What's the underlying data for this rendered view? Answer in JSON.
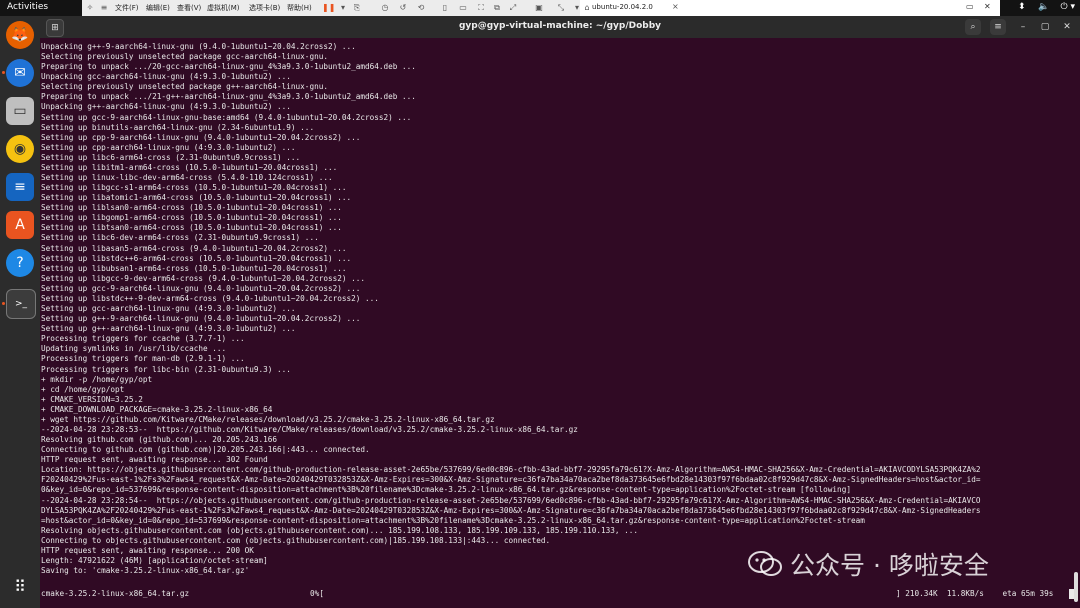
{
  "topbar": {
    "activities": "Activities",
    "menu": [
      "文件(F)",
      "编辑(E)",
      "查看(V)",
      "虚拟机(M)",
      "选项卡(B)",
      "帮助(H)"
    ],
    "vm_tab": "ubuntu-20.04.2.0",
    "tab_close": "×"
  },
  "dock": {
    "items": [
      {
        "name": "firefox-icon",
        "bg": "#e66000"
      },
      {
        "name": "thunderbird-icon",
        "bg": "#1f72d6"
      },
      {
        "name": "files-icon",
        "bg": "#bfbfbf"
      },
      {
        "name": "rhythmbox-icon",
        "bg": "#f5c211"
      },
      {
        "name": "libreoffice-writer-icon",
        "bg": "#1565c0"
      },
      {
        "name": "ubuntu-software-icon",
        "bg": "#e95420"
      },
      {
        "name": "help-icon",
        "bg": "#1e88e5"
      },
      {
        "name": "terminal-icon",
        "bg": "#3c3c3c"
      }
    ]
  },
  "terminal": {
    "title": "gyp@gyp-virtual-machine: ~/gyp/Dobby",
    "lines": [
      "Unpacking g++-9-aarch64-linux-gnu (9.4.0-1ubuntu1~20.04.2cross2) ...",
      "Selecting previously unselected package gcc-aarch64-linux-gnu.",
      "Preparing to unpack .../20-gcc-aarch64-linux-gnu_4%3a9.3.0-1ubuntu2_amd64.deb ...",
      "Unpacking gcc-aarch64-linux-gnu (4:9.3.0-1ubuntu2) ...",
      "Selecting previously unselected package g++-aarch64-linux-gnu.",
      "Preparing to unpack .../21-g++-aarch64-linux-gnu_4%3a9.3.0-1ubuntu2_amd64.deb ...",
      "Unpacking g++-aarch64-linux-gnu (4:9.3.0-1ubuntu2) ...",
      "Setting up gcc-9-aarch64-linux-gnu-base:amd64 (9.4.0-1ubuntu1~20.04.2cross2) ...",
      "Setting up binutils-aarch64-linux-gnu (2.34-6ubuntu1.9) ...",
      "Setting up cpp-9-aarch64-linux-gnu (9.4.0-1ubuntu1~20.04.2cross2) ...",
      "Setting up cpp-aarch64-linux-gnu (4:9.3.0-1ubuntu2) ...",
      "Setting up libc6-arm64-cross (2.31-0ubuntu9.9cross1) ...",
      "Setting up libitm1-arm64-cross (10.5.0-1ubuntu1~20.04cross1) ...",
      "Setting up linux-libc-dev-arm64-cross (5.4.0-110.124cross1) ...",
      "Setting up libgcc-s1-arm64-cross (10.5.0-1ubuntu1~20.04cross1) ...",
      "Setting up libatomic1-arm64-cross (10.5.0-1ubuntu1~20.04cross1) ...",
      "Setting up liblsan0-arm64-cross (10.5.0-1ubuntu1~20.04cross1) ...",
      "Setting up libgomp1-arm64-cross (10.5.0-1ubuntu1~20.04cross1) ...",
      "Setting up libtsan0-arm64-cross (10.5.0-1ubuntu1~20.04cross1) ...",
      "Setting up libc6-dev-arm64-cross (2.31-0ubuntu9.9cross1) ...",
      "Setting up libasan5-arm64-cross (9.4.0-1ubuntu1~20.04.2cross2) ...",
      "Setting up libstdc++6-arm64-cross (10.5.0-1ubuntu1~20.04cross1) ...",
      "Setting up libubsan1-arm64-cross (10.5.0-1ubuntu1~20.04cross1) ...",
      "Setting up libgcc-9-dev-arm64-cross (9.4.0-1ubuntu1~20.04.2cross2) ...",
      "Setting up gcc-9-aarch64-linux-gnu (9.4.0-1ubuntu1~20.04.2cross2) ...",
      "Setting up libstdc++-9-dev-arm64-cross (9.4.0-1ubuntu1~20.04.2cross2) ...",
      "Setting up gcc-aarch64-linux-gnu (4:9.3.0-1ubuntu2) ...",
      "Setting up g++-9-aarch64-linux-gnu (9.4.0-1ubuntu1~20.04.2cross2) ...",
      "Setting up g++-aarch64-linux-gnu (4:9.3.0-1ubuntu2) ...",
      "Processing triggers for ccache (3.7.7-1) ...",
      "Updating symlinks in /usr/lib/ccache ...",
      "Processing triggers for man-db (2.9.1-1) ...",
      "Processing triggers for libc-bin (2.31-0ubuntu9.3) ...",
      "+ mkdir -p /home/gyp/opt",
      "+ cd /home/gyp/opt",
      "+ CMAKE_VERSION=3.25.2",
      "+ CMAKE_DOWNLOAD_PACKAGE=cmake-3.25.2-linux-x86_64",
      "+ wget https://github.com/Kitware/CMake/releases/download/v3.25.2/cmake-3.25.2-linux-x86_64.tar.gz",
      "--2024-04-28 23:28:53--  https://github.com/Kitware/CMake/releases/download/v3.25.2/cmake-3.25.2-linux-x86_64.tar.gz",
      "Resolving github.com (github.com)... 20.205.243.166",
      "Connecting to github.com (github.com)|20.205.243.166|:443... connected.",
      "HTTP request sent, awaiting response... 302 Found",
      "Location: https://objects.githubusercontent.com/github-production-release-asset-2e65be/537699/6ed0c896-cfbb-43ad-bbf7-29295fa79c61?X-Amz-Algorithm=AWS4-HMAC-SHA256&X-Amz-Credential=AKIAVCODYLSA53PQK4ZA%2",
      "F20240429%2Fus-east-1%2Fs3%2Faws4_request&X-Amz-Date=20240429T032853Z&X-Amz-Expires=300&X-Amz-Signature=c36fa7ba34a70aca2bef8da373645e6fbd28e14303f97f6bdaa02c8f929d47c8&X-Amz-SignedHeaders=host&actor_id=",
      "0&key_id=0&repo_id=537699&response-content-disposition=attachment%3B%20filename%3Dcmake-3.25.2-linux-x86_64.tar.gz&response-content-type=application%2Foctet-stream [following]",
      "--2024-04-28 23:28:54--  https://objects.githubusercontent.com/github-production-release-asset-2e65be/537699/6ed0c896-cfbb-43ad-bbf7-29295fa79c61?X-Amz-Algorithm=AWS4-HMAC-SHA256&X-Amz-Credential=AKIAVCO",
      "DYLSA53PQK4ZA%2F20240429%2Fus-east-1%2Fs3%2Faws4_request&X-Amz-Date=20240429T032853Z&X-Amz-Expires=300&X-Amz-Signature=c36fa7ba34a70aca2bef8da373645e6fbd28e14303f97f6bdaa02c8f929d47c8&X-Amz-SignedHeaders",
      "=host&actor_id=0&key_id=0&repo_id=537699&response-content-disposition=attachment%3B%20filename%3Dcmake-3.25.2-linux-x86_64.tar.gz&response-content-type=application%2Foctet-stream",
      "Resolving objects.githubusercontent.com (objects.githubusercontent.com)... 185.199.108.133, 185.199.109.133, 185.199.110.133, ...",
      "Connecting to objects.githubusercontent.com (objects.githubusercontent.com)|185.199.108.133|:443... connected.",
      "HTTP request sent, awaiting response... 200 OK",
      "Length: 47921622 (46M) [application/octet-stream]",
      "Saving to: 'cmake-3.25.2-linux-x86_64.tar.gz'",
      ""
    ],
    "progress": {
      "file": "cmake-3.25.2-linux-x86_64.tar.gz",
      "percent": "0%[",
      "stats": "] 210.34K  11.8KB/s    eta 65m 39s"
    }
  },
  "watermark": {
    "text": "公众号 · 哆啦安全"
  }
}
